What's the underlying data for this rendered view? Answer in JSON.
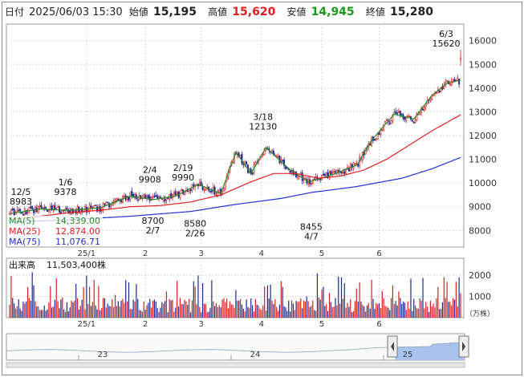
{
  "header": {
    "date_label": "日付",
    "datetime": "2025/06/03 15:30",
    "open_label": "始値",
    "open": "15,195",
    "high_label": "高値",
    "high": "15,620",
    "low_label": "安値",
    "low": "14,945",
    "close_label": "終値",
    "close": "15,280"
  },
  "colors": {
    "up": "#d62020",
    "down": "#1a2a8c",
    "ma5": "#2a8a2a",
    "ma25": "#e02020",
    "ma75": "#2030d0",
    "high_value": "#e02020",
    "low_value": "#1a9a1a",
    "navigator_fill": "#a8c4ee"
  },
  "legend": [
    {
      "label": "MA(5)",
      "value": "14,339.00",
      "color": "#2a8a2a"
    },
    {
      "label": "MA(25)",
      "value": "12,874.00",
      "color": "#e02020"
    },
    {
      "label": "MA(75)",
      "value": "11,076.71",
      "color": "#2030d0"
    }
  ],
  "volume_panel": {
    "label": "出来高",
    "value": "11,503,400株",
    "unit": "（万株）"
  },
  "annotations": [
    {
      "date": "12/5",
      "value": "8983",
      "pos": "above"
    },
    {
      "date": "1/6",
      "value": "9378",
      "pos": "above"
    },
    {
      "date": "2/4",
      "value": "9908",
      "pos": "above"
    },
    {
      "date": "2/19",
      "value": "9990",
      "pos": "above"
    },
    {
      "date": "3/18",
      "value": "12130",
      "pos": "above"
    },
    {
      "date": "6/3",
      "value": "15620",
      "pos": "above"
    },
    {
      "date": "2/7",
      "value": "8700",
      "pos": "below"
    },
    {
      "date": "2/26",
      "value": "8580",
      "pos": "below"
    },
    {
      "date": "4/7",
      "value": "8455",
      "pos": "below"
    }
  ],
  "navigator": {
    "labels": [
      "23",
      "24",
      "25"
    ]
  },
  "chart_data": {
    "type": "candlestick",
    "x_axis_labels": [
      "25/1",
      "2",
      "3",
      "4",
      "5",
      "6"
    ],
    "price_axis": {
      "ticks": [
        8000,
        9000,
        10000,
        11000,
        12000,
        13000,
        14000,
        15000,
        16000
      ],
      "ylim": [
        7300,
        16700
      ]
    },
    "volume_axis": {
      "ticks": [
        1000,
        2000
      ],
      "ylim": [
        0,
        2800
      ],
      "unit": "万株"
    },
    "series": [
      {
        "name": "MA(5)",
        "anchors": [
          [
            0,
            8700
          ],
          [
            20,
            8900
          ],
          [
            40,
            8850
          ],
          [
            60,
            8950
          ],
          [
            80,
            9450
          ],
          [
            95,
            9300
          ],
          [
            110,
            9450
          ],
          [
            125,
            9950
          ],
          [
            140,
            9550
          ],
          [
            150,
            11300
          ],
          [
            160,
            10400
          ],
          [
            170,
            11500
          ],
          [
            185,
            10600
          ],
          [
            198,
            10050
          ],
          [
            212,
            10300
          ],
          [
            230,
            10750
          ],
          [
            240,
            11800
          ],
          [
            255,
            12900
          ],
          [
            268,
            12700
          ],
          [
            280,
            13700
          ],
          [
            290,
            14200
          ],
          [
            299,
            14340
          ]
        ]
      },
      {
        "name": "MA(25)",
        "anchors": [
          [
            0,
            8450
          ],
          [
            20,
            8600
          ],
          [
            40,
            8750
          ],
          [
            60,
            8850
          ],
          [
            80,
            9000
          ],
          [
            100,
            9050
          ],
          [
            120,
            9200
          ],
          [
            140,
            9500
          ],
          [
            160,
            10050
          ],
          [
            175,
            10400
          ],
          [
            190,
            10400
          ],
          [
            205,
            10200
          ],
          [
            220,
            10300
          ],
          [
            235,
            10550
          ],
          [
            250,
            11000
          ],
          [
            265,
            11600
          ],
          [
            280,
            12200
          ],
          [
            299,
            12874
          ]
        ]
      },
      {
        "name": "MA(75)",
        "anchors": [
          [
            0,
            8350
          ],
          [
            40,
            8450
          ],
          [
            80,
            8600
          ],
          [
            120,
            8800
          ],
          [
            150,
            9100
          ],
          [
            180,
            9350
          ],
          [
            200,
            9600
          ],
          [
            230,
            9850
          ],
          [
            260,
            10200
          ],
          [
            280,
            10600
          ],
          [
            299,
            11077
          ]
        ]
      }
    ]
  }
}
